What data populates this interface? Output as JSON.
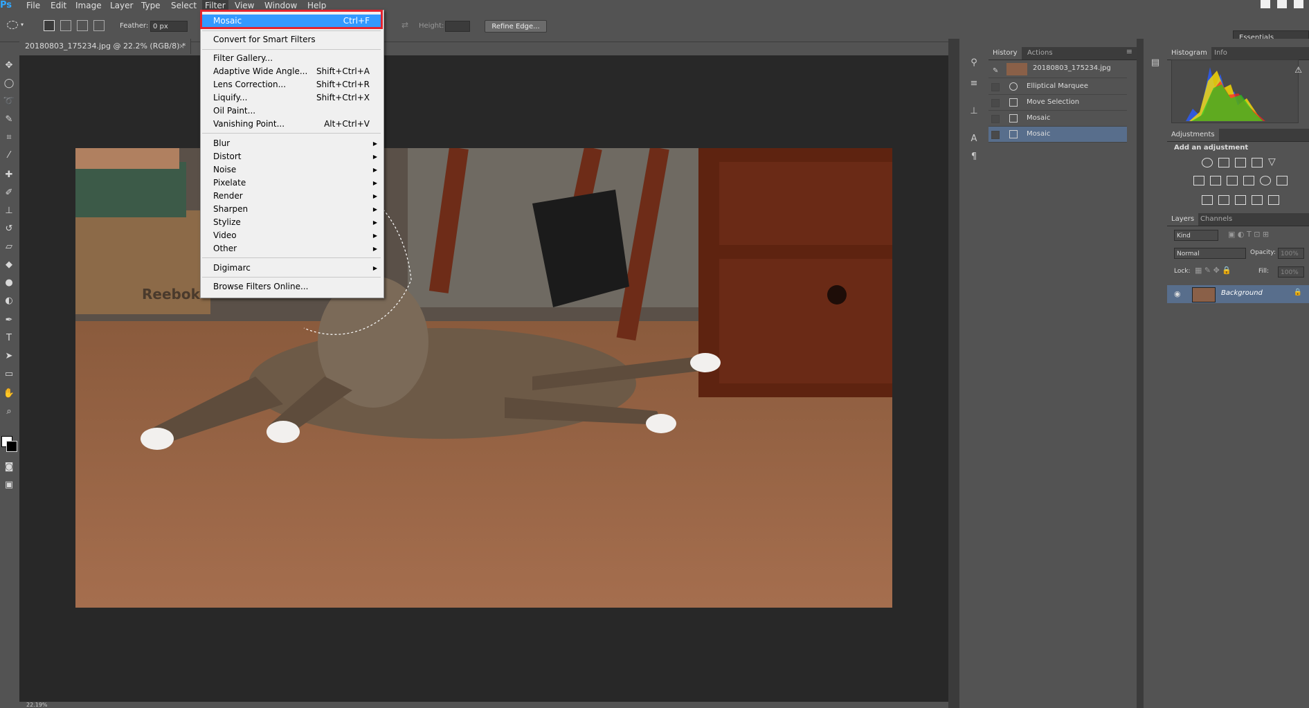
{
  "app": {
    "logo": "Ps"
  },
  "menubar": {
    "items": [
      "File",
      "Edit",
      "Image",
      "Layer",
      "Type",
      "Select",
      "Filter",
      "View",
      "Window",
      "Help"
    ]
  },
  "options": {
    "feather_label": "Feather:",
    "feather_value": "0 px",
    "height_label": "Height:",
    "refine_edge": "Refine Edge...",
    "workspace": "Essentials"
  },
  "document": {
    "tab_title": "20180803_175234.jpg @ 22.2% (RGB/8) *",
    "close": "×",
    "zoom": "22.19%"
  },
  "filter_menu": {
    "items": [
      {
        "label": "Mosaic",
        "shortcut": "Ctrl+F"
      },
      {
        "label": "Convert for Smart Filters",
        "shortcut": ""
      },
      {
        "label": "Filter Gallery...",
        "shortcut": ""
      },
      {
        "label": "Adaptive Wide Angle...",
        "shortcut": "Shift+Ctrl+A"
      },
      {
        "label": "Lens Correction...",
        "shortcut": "Shift+Ctrl+R"
      },
      {
        "label": "Liquify...",
        "shortcut": "Shift+Ctrl+X"
      },
      {
        "label": "Oil Paint...",
        "shortcut": ""
      },
      {
        "label": "Vanishing Point...",
        "shortcut": "Alt+Ctrl+V"
      },
      {
        "label": "Blur",
        "shortcut": ""
      },
      {
        "label": "Distort",
        "shortcut": ""
      },
      {
        "label": "Noise",
        "shortcut": ""
      },
      {
        "label": "Pixelate",
        "shortcut": ""
      },
      {
        "label": "Render",
        "shortcut": ""
      },
      {
        "label": "Sharpen",
        "shortcut": ""
      },
      {
        "label": "Stylize",
        "shortcut": ""
      },
      {
        "label": "Video",
        "shortcut": ""
      },
      {
        "label": "Other",
        "shortcut": ""
      },
      {
        "label": "Digimarc",
        "shortcut": ""
      },
      {
        "label": "Browse Filters Online...",
        "shortcut": ""
      }
    ]
  },
  "history": {
    "tabs": [
      "History",
      "Actions"
    ],
    "snapshot": "20180803_175234.jpg",
    "rows": [
      "Elliptical Marquee",
      "Move Selection",
      "Mosaic",
      "Mosaic"
    ]
  },
  "right_panel": {
    "top_tabs": [
      "Histogram",
      "Info"
    ],
    "adjustments_tab": "Adjustments",
    "add_adjustment": "Add an adjustment",
    "layers_tabs": [
      "Layers",
      "Channels"
    ],
    "kind": "Kind",
    "blend_mode": "Normal",
    "opacity_label": "Opacity:",
    "opacity_value": "100%",
    "lock_label": "Lock:",
    "fill_label": "Fill:",
    "fill_value": "100%",
    "layer_name": "Background"
  },
  "colors": {
    "accent": "#3399ff",
    "highlight_box": "#e3232e",
    "selected_history": "#586e8c"
  }
}
